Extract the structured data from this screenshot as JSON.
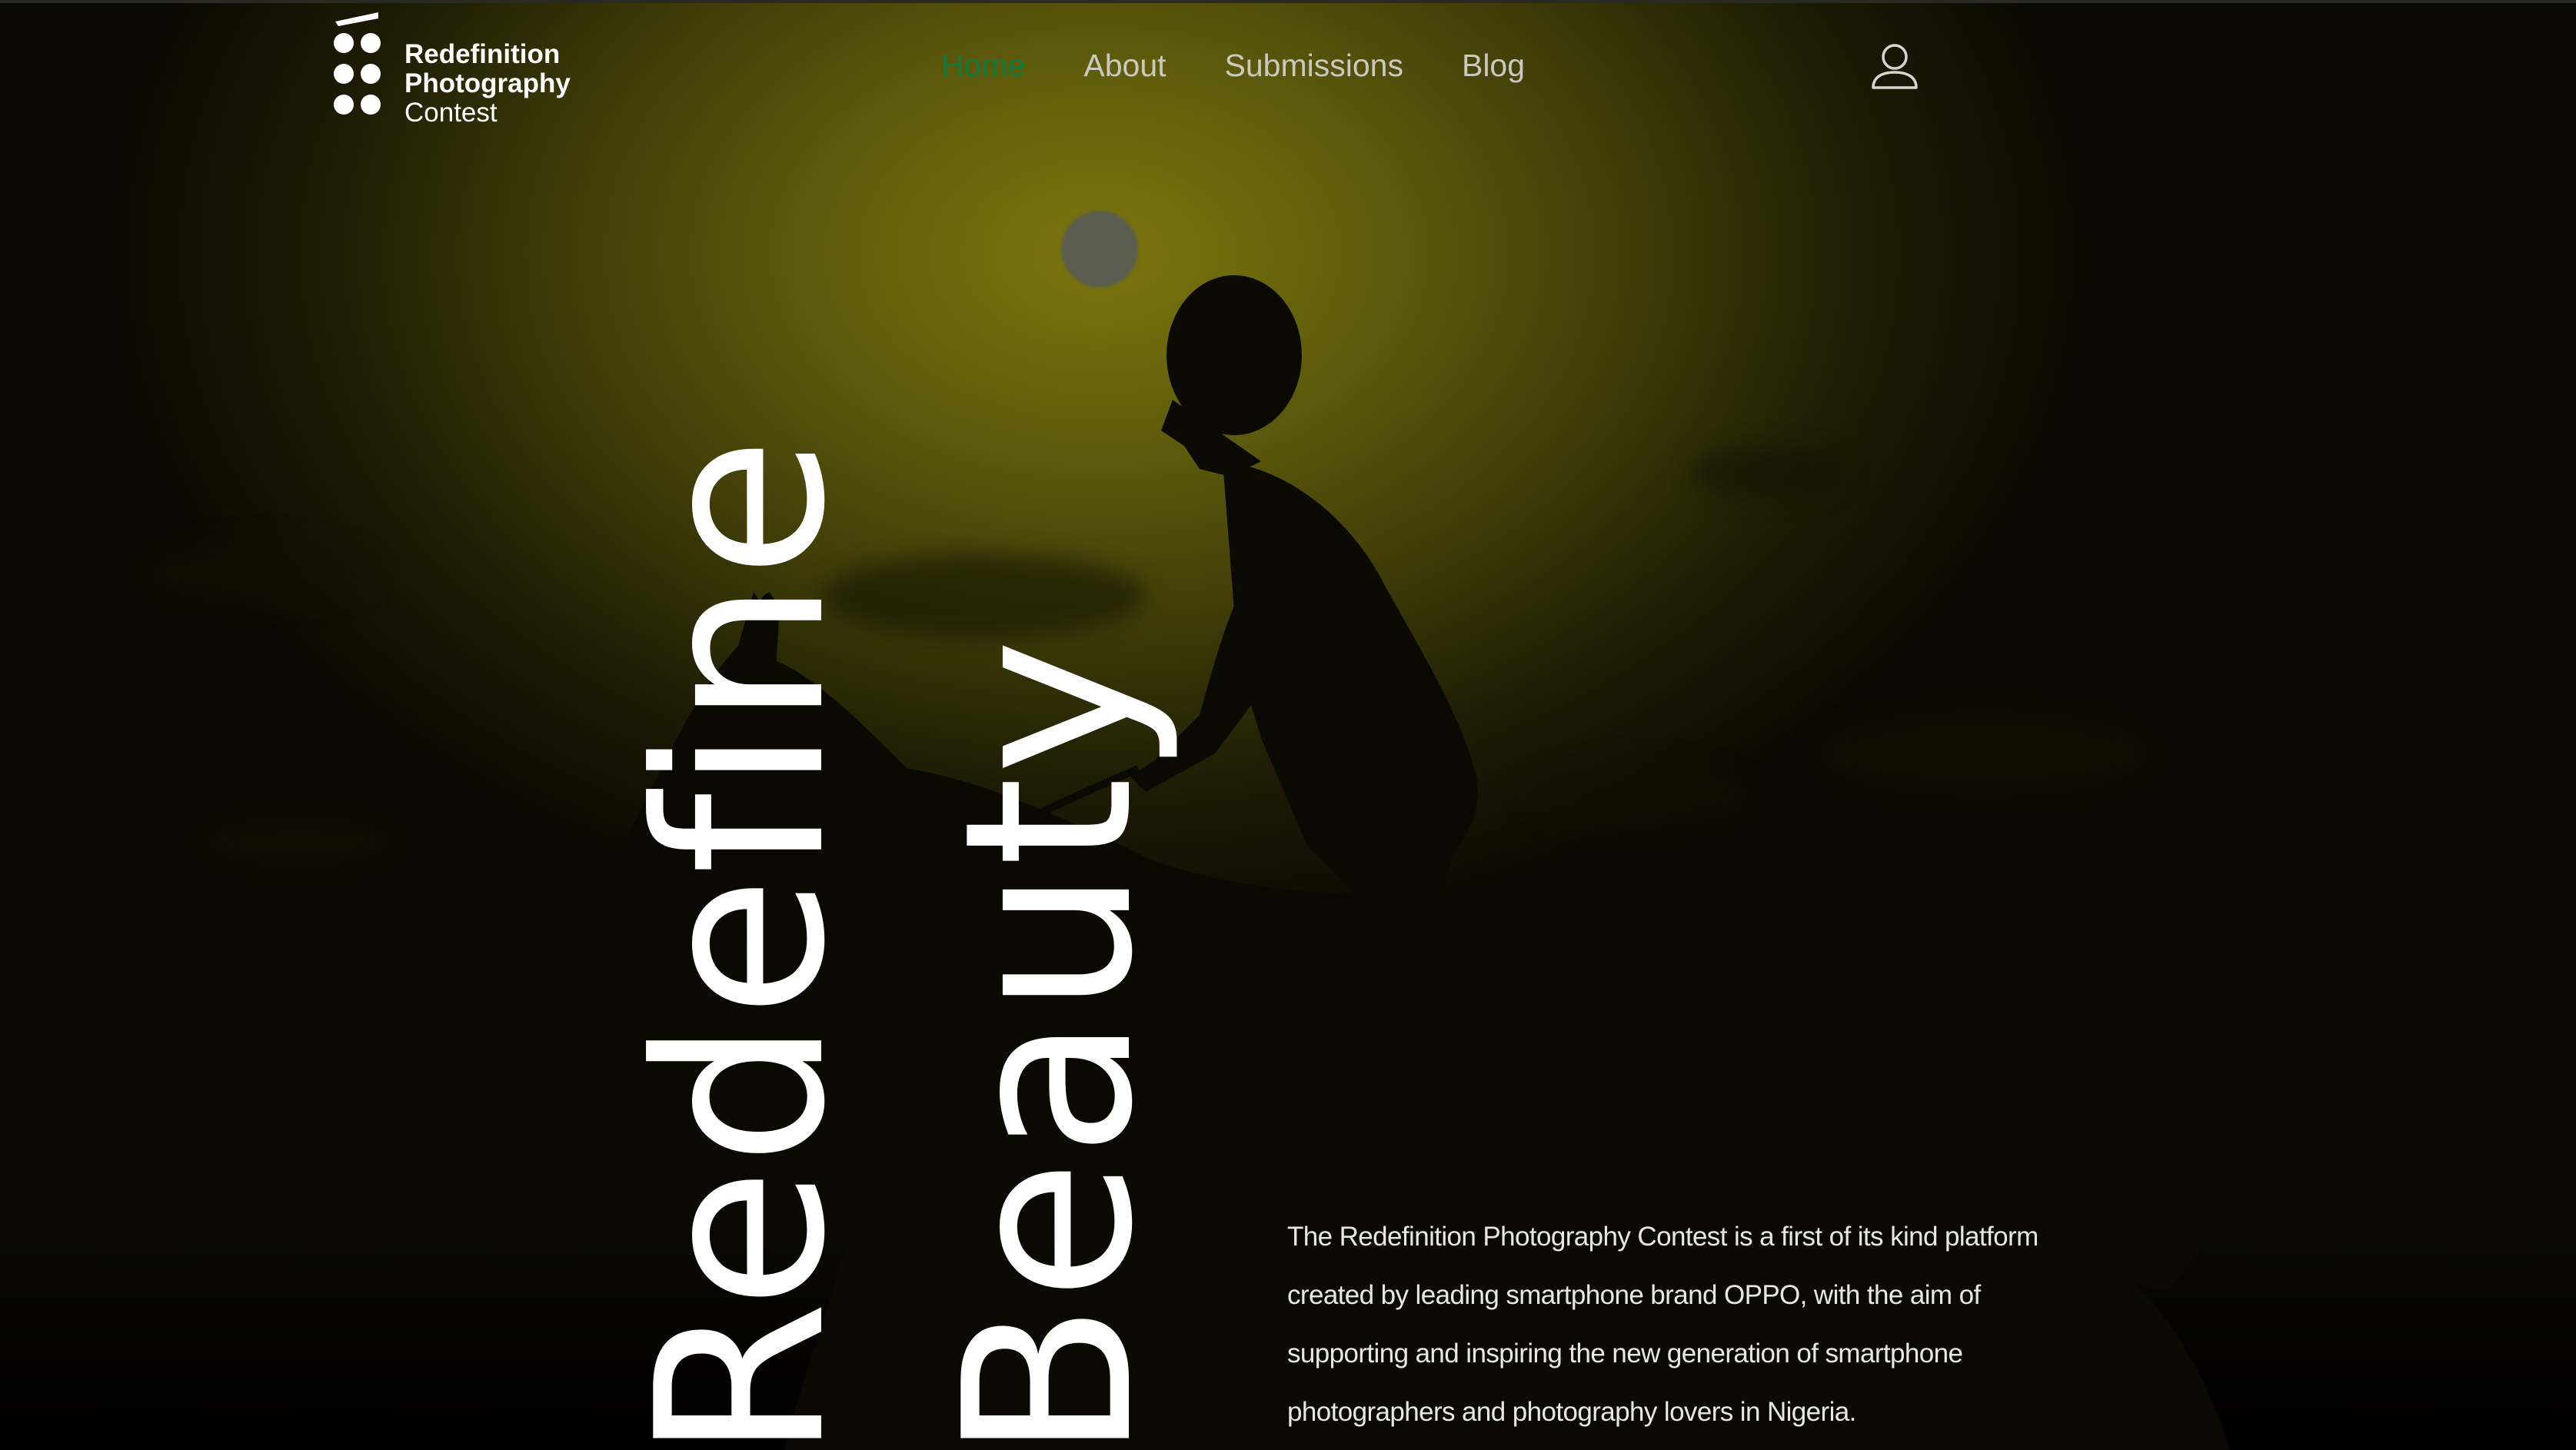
{
  "header": {
    "logo": {
      "line1": "Redefinition",
      "line2": "Photography",
      "line3": "Contest"
    },
    "nav": [
      {
        "label": "Home",
        "active": true
      },
      {
        "label": "About",
        "active": false
      },
      {
        "label": "Submissions",
        "active": false
      },
      {
        "label": "Blog",
        "active": false
      }
    ],
    "account_icon": "user-icon"
  },
  "hero": {
    "title_line1": "Redefine",
    "title_line2": "Beauty",
    "description": "The Redefinition Photography Contest is a first of its kind platform created by leading smartphone brand OPPO, with the aim of supporting and inspiring the new generation of smartphone photographers and photography lovers in Nigeria."
  },
  "colors": {
    "active_nav": "#0e7a3e",
    "nav_text": "#c9c9c2",
    "hero_text": "#ffffff",
    "sky": "#6b670d"
  }
}
